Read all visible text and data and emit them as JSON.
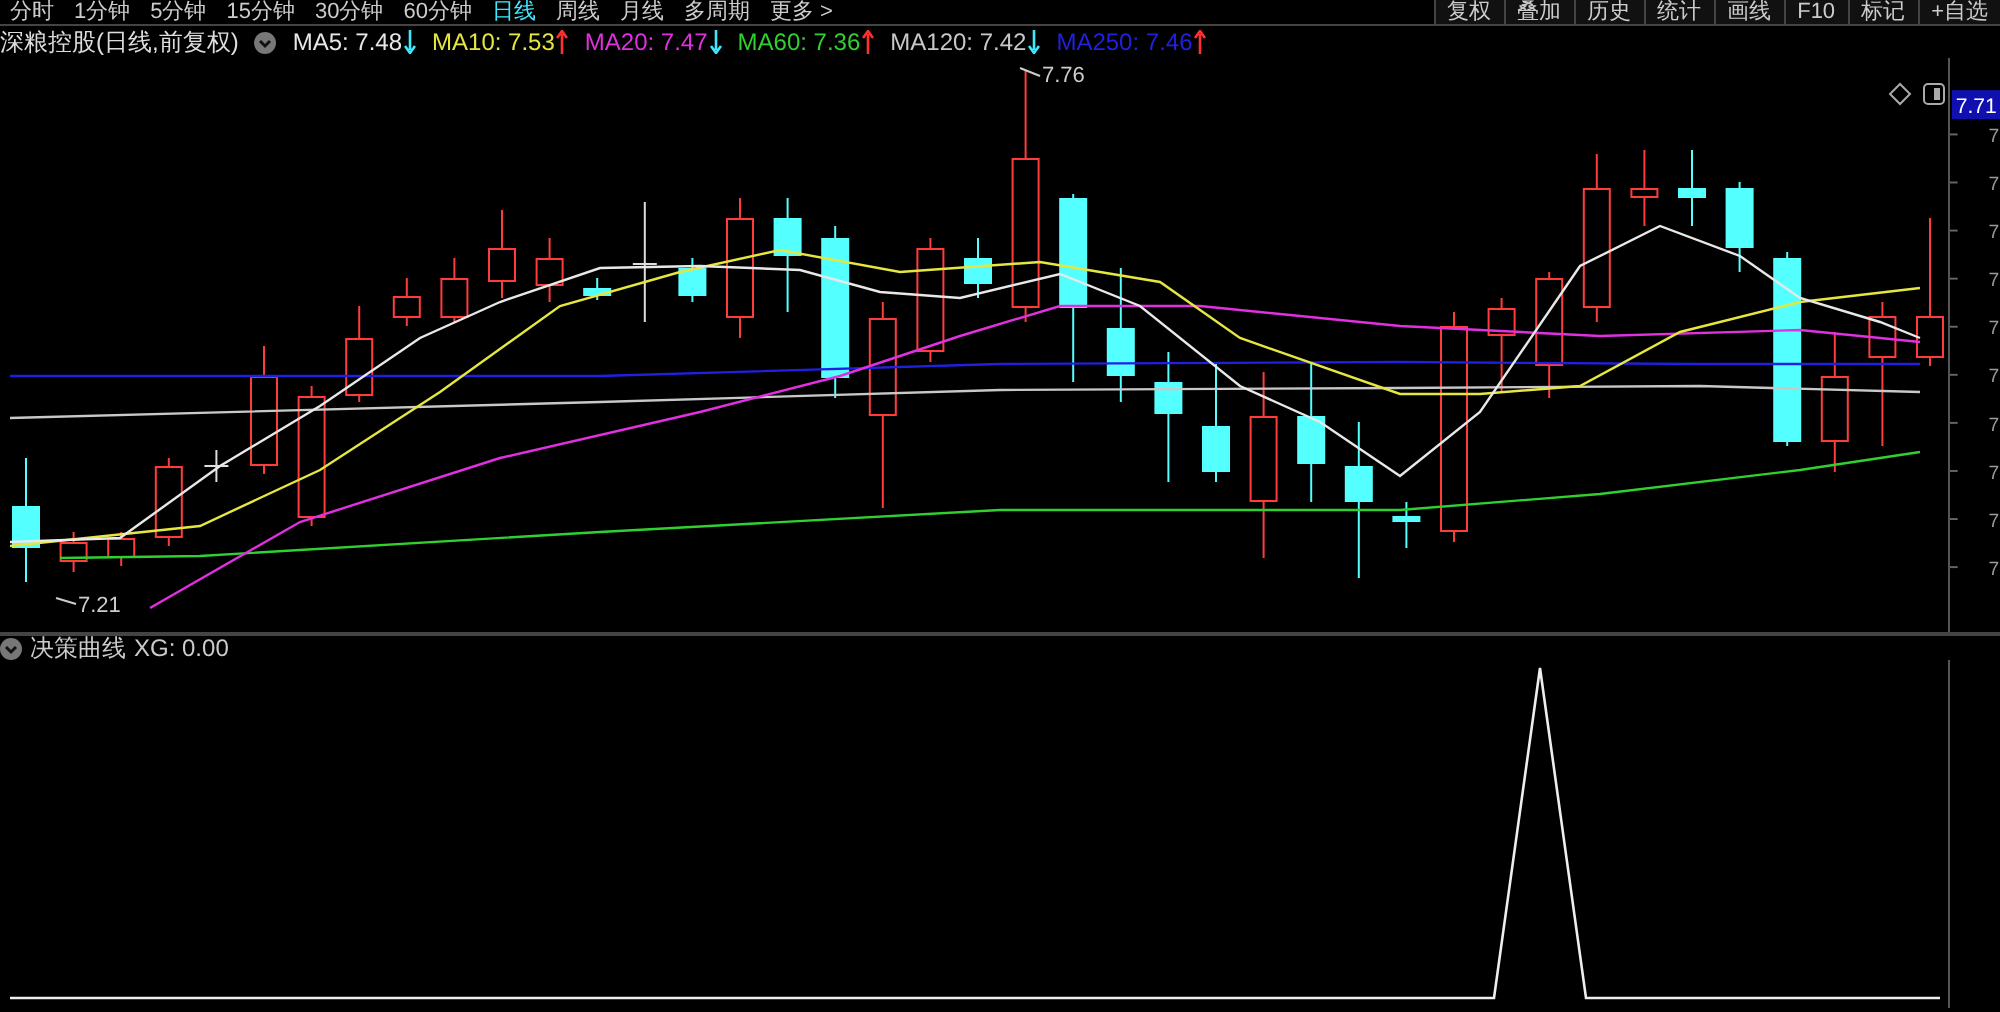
{
  "period_tabs": [
    {
      "label": "分时",
      "selected": false
    },
    {
      "label": "1分钟",
      "selected": false
    },
    {
      "label": "5分钟",
      "selected": false
    },
    {
      "label": "15分钟",
      "selected": false
    },
    {
      "label": "30分钟",
      "selected": false
    },
    {
      "label": "60分钟",
      "selected": false
    },
    {
      "label": "日线",
      "selected": true
    },
    {
      "label": "周线",
      "selected": false
    },
    {
      "label": "月线",
      "selected": false
    },
    {
      "label": "多周期",
      "selected": false
    },
    {
      "label": "更多 >",
      "selected": false
    }
  ],
  "tool_buttons": [
    "复权",
    "叠加",
    "历史",
    "统计",
    "画线",
    "F10",
    "标记",
    "+自选"
  ],
  "chart_title": "深粮控股(日线,前复权)",
  "moving_averages": [
    {
      "label": "MA5: 7.48",
      "color": "#e8e8e8",
      "rising": false
    },
    {
      "label": "MA10: 7.53",
      "color": "#e6e640",
      "rising": true
    },
    {
      "label": "MA20: 7.47",
      "color": "#e030e0",
      "rising": false
    },
    {
      "label": "MA60: 7.36",
      "color": "#30d030",
      "rising": true
    },
    {
      "label": "MA120: 7.42",
      "color": "#c8c8c8",
      "rising": false
    },
    {
      "label": "MA250: 7.46",
      "color": "#2020e0",
      "rising": true
    }
  ],
  "high_marker": "7.76",
  "low_marker": "7.21",
  "price_axis": {
    "current": "7.71",
    "ticks": [
      "7",
      "7",
      "7",
      "7",
      "7",
      "7",
      "7",
      "7",
      "7",
      "7"
    ]
  },
  "indicator": {
    "title": "决策曲线",
    "reading": "XG: 0.00"
  }
}
